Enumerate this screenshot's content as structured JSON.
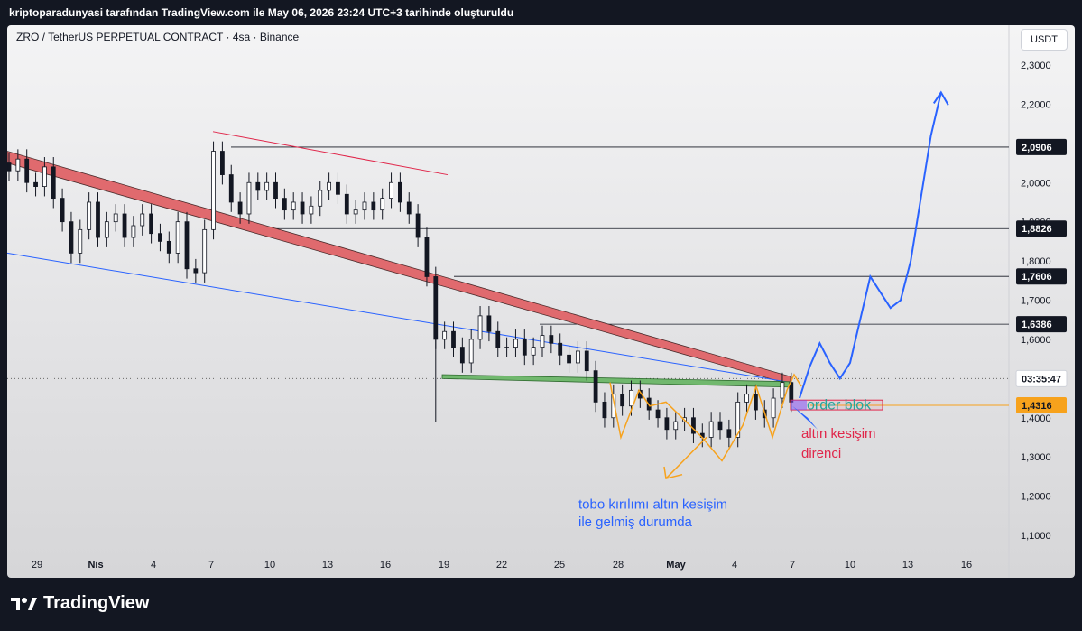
{
  "header": {
    "caption": "kriptoparadunyasi tarafından TradingView.com ile May 06, 2026 23:24 UTC+3 tarihinde oluşturuldu"
  },
  "chart_title": "ZRO / TetherUS PERPETUAL CONTRACT · 4sa · Binance",
  "currency_button": "USDT",
  "brand": "TradingView",
  "colors": {
    "background": "#131722",
    "candle": "#131722",
    "red_band": "#e06a6e",
    "green_band": "#71b86e",
    "blue_line": "#2962ff",
    "orange": "#f7a21c",
    "annotation_red": "#e0264a",
    "annotation_blue": "#2962ff",
    "order_block_text": "#26a69a"
  },
  "chart_data": {
    "type": "line",
    "x_axis_labels": [
      "29",
      "Nis",
      "4",
      "7",
      "10",
      "13",
      "16",
      "19",
      "22",
      "25",
      "28",
      "May",
      "4",
      "7",
      "10",
      "13",
      "16"
    ],
    "y_axis": {
      "ticks": [
        "2,3000",
        "2,2000",
        "2,0000",
        "1,9000",
        "1,8000",
        "1,7000",
        "1,6000",
        "1,4000",
        "1,3000",
        "1,2000",
        "1,1000"
      ],
      "ylim": [
        1.05,
        2.36
      ]
    },
    "price_labels": [
      {
        "label": "2,0906",
        "value": 2.0906,
        "kind": "level"
      },
      {
        "label": "1,8826",
        "value": 1.8826,
        "kind": "level"
      },
      {
        "label": "1,7606",
        "value": 1.7606,
        "kind": "level"
      },
      {
        "label": "1,6386",
        "value": 1.6386,
        "kind": "level"
      },
      {
        "label": "03:35:47",
        "value": 1.5,
        "kind": "countdown"
      },
      {
        "label": "1,4316",
        "value": 1.4316,
        "kind": "current"
      }
    ],
    "series": [
      {
        "values": [
          [
            0,
            2.03
          ],
          [
            1,
            2.06
          ],
          [
            2,
            2.0
          ],
          [
            3,
            1.99
          ],
          [
            4,
            2.04
          ],
          [
            5,
            1.96
          ],
          [
            6,
            1.9
          ],
          [
            7,
            1.82
          ],
          [
            8,
            1.88
          ],
          [
            9,
            1.95
          ],
          [
            10,
            1.86
          ],
          [
            11,
            1.9
          ],
          [
            12,
            1.92
          ],
          [
            13,
            1.86
          ],
          [
            14,
            1.89
          ],
          [
            15,
            1.92
          ],
          [
            16,
            1.87
          ],
          [
            17,
            1.85
          ],
          [
            18,
            1.82
          ],
          [
            19,
            1.9
          ],
          [
            20,
            1.78
          ],
          [
            21,
            1.77
          ],
          [
            22,
            1.88
          ],
          [
            23,
            2.08
          ],
          [
            24,
            2.02
          ],
          [
            25,
            1.95
          ],
          [
            26,
            1.92
          ],
          [
            27,
            2.0
          ],
          [
            28,
            1.98
          ],
          [
            29,
            2.0
          ],
          [
            30,
            1.96
          ],
          [
            31,
            1.93
          ],
          [
            32,
            1.95
          ],
          [
            33,
            1.92
          ],
          [
            34,
            1.94
          ],
          [
            35,
            1.98
          ],
          [
            36,
            2.0
          ],
          [
            37,
            1.97
          ],
          [
            38,
            1.92
          ],
          [
            39,
            1.93
          ],
          [
            40,
            1.95
          ],
          [
            41,
            1.93
          ],
          [
            42,
            1.96
          ],
          [
            43,
            2.0
          ],
          [
            44,
            1.95
          ],
          [
            45,
            1.92
          ],
          [
            46,
            1.86
          ],
          [
            47,
            1.76
          ],
          [
            48,
            1.6
          ],
          [
            49,
            1.62
          ],
          [
            50,
            1.58
          ],
          [
            51,
            1.54
          ],
          [
            52,
            1.6
          ],
          [
            53,
            1.66
          ],
          [
            54,
            1.62
          ],
          [
            55,
            1.58
          ],
          [
            56,
            1.58
          ],
          [
            57,
            1.6
          ],
          [
            58,
            1.56
          ],
          [
            59,
            1.58
          ],
          [
            60,
            1.61
          ],
          [
            61,
            1.59
          ],
          [
            62,
            1.56
          ],
          [
            63,
            1.54
          ],
          [
            64,
            1.57
          ],
          [
            65,
            1.52
          ],
          [
            66,
            1.44
          ],
          [
            67,
            1.4
          ],
          [
            68,
            1.46
          ],
          [
            69,
            1.43
          ],
          [
            70,
            1.47
          ],
          [
            71,
            1.45
          ],
          [
            72,
            1.42
          ],
          [
            73,
            1.4
          ],
          [
            74,
            1.37
          ],
          [
            75,
            1.39
          ],
          [
            76,
            1.4
          ],
          [
            77,
            1.36
          ],
          [
            78,
            1.35
          ],
          [
            79,
            1.39
          ],
          [
            80,
            1.37
          ],
          [
            81,
            1.35
          ],
          [
            82,
            1.44
          ],
          [
            83,
            1.46
          ],
          [
            84,
            1.42
          ],
          [
            85,
            1.4
          ],
          [
            86,
            1.45
          ],
          [
            87,
            1.49
          ],
          [
            88,
            1.44
          ]
        ]
      },
      {
        "values": [
          [
            88,
            1.45
          ],
          [
            89,
            1.53
          ],
          [
            90,
            1.59
          ],
          [
            91,
            1.54
          ],
          [
            92,
            1.5
          ],
          [
            93,
            1.54
          ],
          [
            94,
            1.65
          ],
          [
            95,
            1.76
          ],
          [
            96,
            1.72
          ],
          [
            97,
            1.68
          ],
          [
            98,
            1.7
          ],
          [
            99,
            1.8
          ],
          [
            100,
            1.96
          ],
          [
            101,
            2.12
          ],
          [
            102,
            2.23
          ]
        ]
      }
    ],
    "annotations": [
      {
        "text": "order blok",
        "value": 1.435
      },
      {
        "text": "altın kesişim",
        "value": 1.36
      },
      {
        "text": "direnci",
        "value": 1.31
      },
      {
        "text": "tobo kırılımı altın kesişim",
        "value": 1.18
      },
      {
        "text": "ile gelmiş durumda",
        "value": 1.135
      }
    ]
  }
}
